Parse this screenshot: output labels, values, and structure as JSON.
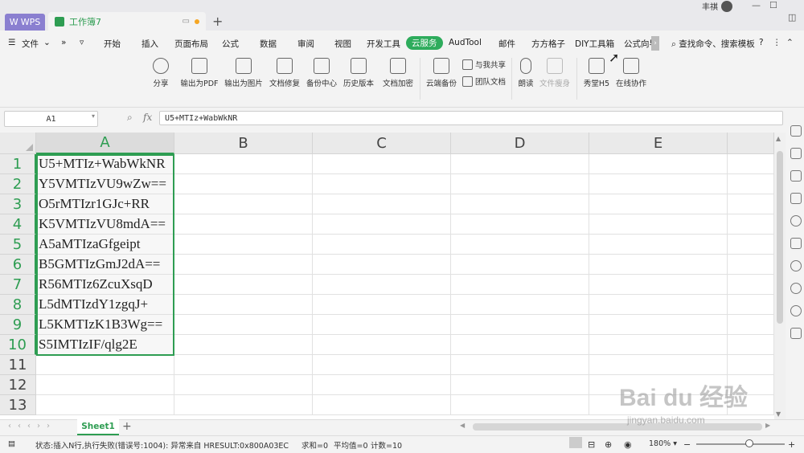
{
  "titlebar": {
    "wps_tab": "WPS",
    "doc_tab": "工作簿7",
    "new_tab": "+",
    "user_name": "丰祺"
  },
  "menu": {
    "file": "文件",
    "items": [
      "开始",
      "插入",
      "页面布局",
      "公式",
      "数据",
      "审阅",
      "视图",
      "开发工具",
      "云服务",
      "AudTool",
      "邮件",
      "方方格子",
      "DIY工具箱",
      "公式向导"
    ],
    "active": "云服务",
    "search": "查找命令、搜索模板"
  },
  "ribbon": {
    "buttons": [
      {
        "label": "分享",
        "icon": "share-icon"
      },
      {
        "label": "输出为PDF",
        "icon": "pdf-icon"
      },
      {
        "label": "输出为图片",
        "icon": "image-icon"
      },
      {
        "label": "文档修复",
        "icon": "repair-icon"
      },
      {
        "label": "备份中心",
        "icon": "backup-icon"
      },
      {
        "label": "历史版本",
        "icon": "history-icon"
      },
      {
        "label": "文档加密",
        "icon": "encrypt-icon"
      },
      {
        "label": "云端备份",
        "icon": "cloud-backup-icon"
      },
      {
        "label": "与我共享",
        "icon": "shared-icon"
      },
      {
        "label": "团队文档",
        "icon": "team-doc-icon"
      },
      {
        "label": "朗读",
        "icon": "microphone-icon"
      },
      {
        "label": "文件瘦身",
        "icon": "slim-icon"
      },
      {
        "label": "秀堂H5",
        "icon": "h5-icon"
      },
      {
        "label": "在线协作",
        "icon": "collab-icon"
      }
    ]
  },
  "formula_bar": {
    "name_box": "A1",
    "fx": "fx",
    "formula": "U5+MTIz+WabWkNR"
  },
  "sheet": {
    "columns": [
      "A",
      "B",
      "C",
      "D",
      "E"
    ],
    "rows": [
      "1",
      "2",
      "3",
      "4",
      "5",
      "6",
      "7",
      "8",
      "9",
      "10",
      "11",
      "12",
      "13"
    ],
    "column_a_values": [
      "U5+MTIz+WabWkNR",
      "Y5VMTIzVU9wZw==",
      "O5rMTIzr1GJc+RR",
      "K5VMTIzVU8mdA==",
      "A5aMTIzaGfgeipt",
      "B5GMTIzGmJ2dA==",
      "R56MTIz6ZcuXsqD",
      "L5dMTIzdY1zgqJ+",
      "L5KMTIzK1B3Wg==",
      "S5IMTIzIF/qlg2E"
    ],
    "tab": "Sheet1"
  },
  "status": {
    "message": "状态:插入N行,执行失败(错误号:1004): 异常来自 HRESULT:0x800A03EC",
    "sum": "求和=0",
    "average": "平均值=0",
    "count": "计数=10",
    "zoom": "180%"
  },
  "watermark": {
    "brand": "Bai du 经验",
    "url": "jingyan.baidu.com"
  }
}
